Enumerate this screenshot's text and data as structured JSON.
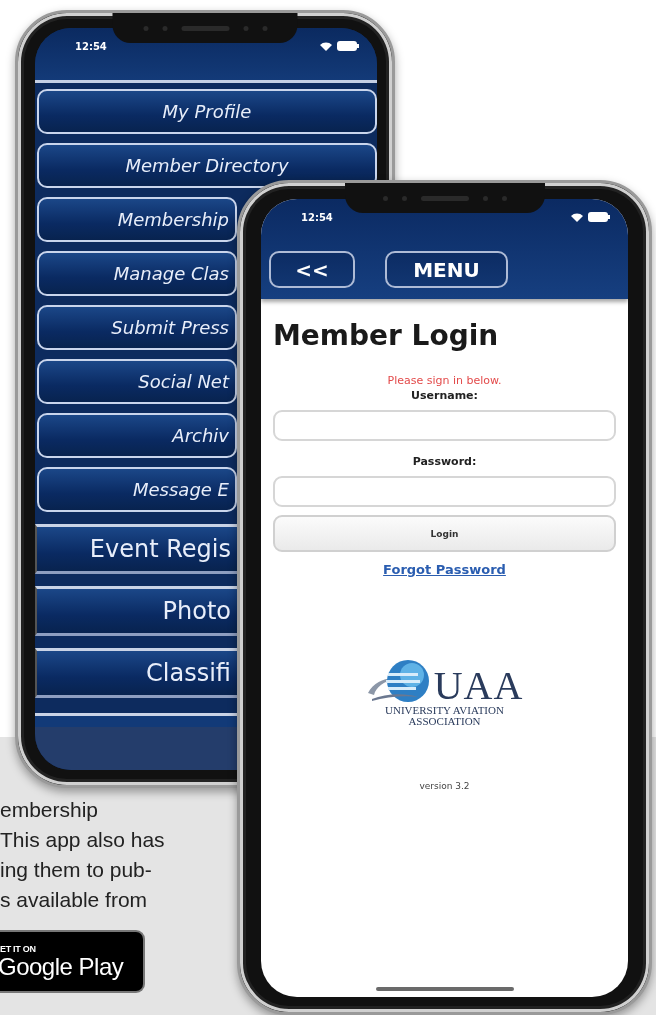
{
  "menu_phone": {
    "status_time": "12:54",
    "menu_items": [
      {
        "label": "My Profile",
        "kind": "rounded"
      },
      {
        "label": "Member Directory",
        "kind": "rounded"
      },
      {
        "label": "Membership",
        "kind": "rounded"
      },
      {
        "label": "Manage Clas",
        "kind": "rounded"
      },
      {
        "label": "Submit Press",
        "kind": "rounded"
      },
      {
        "label": "Social Net",
        "kind": "rounded"
      },
      {
        "label": "Archiv",
        "kind": "rounded"
      },
      {
        "label": "Message E",
        "kind": "rounded"
      },
      {
        "label": "Event Regis",
        "kind": "bar"
      },
      {
        "label": "Photo",
        "kind": "bar"
      },
      {
        "label": "Classifi",
        "kind": "bar"
      }
    ]
  },
  "login_phone": {
    "status_time": "12:54",
    "back_button": "<<",
    "menu_button": "MENU",
    "title": "Member Login",
    "message": "Please sign in below.",
    "fields": [
      {
        "label": "Username:"
      },
      {
        "label": "Password:"
      }
    ],
    "login_button": "Login",
    "forgot_link": "Forgot Password",
    "logo": {
      "acronym": "UAA",
      "name_lines": [
        "UNIVERSITY AVIATION",
        "ASSOCIATION"
      ]
    },
    "version": "version 3.2"
  },
  "promo": {
    "description_lines": [
      "embership",
      "This app also has",
      "ing them to pub-",
      "s available from"
    ],
    "store_badge": {
      "small": "ET IT ON",
      "large": "Google Play"
    }
  }
}
